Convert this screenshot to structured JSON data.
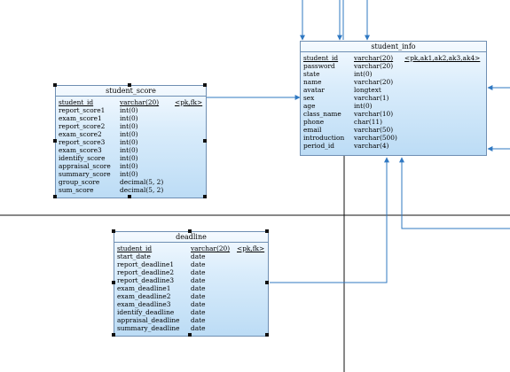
{
  "tables": {
    "student_info": {
      "title": "student_info",
      "pk_row": {
        "name": "student_id",
        "type": "varchar(20)",
        "keys": "<pk,ak1,ak2,ak3,ak4>"
      },
      "rows": [
        {
          "name": "password",
          "type": "varchar(20)"
        },
        {
          "name": "state",
          "type": "int(0)"
        },
        {
          "name": "name",
          "type": "varchar(20)"
        },
        {
          "name": "avatar",
          "type": "longtext"
        },
        {
          "name": "sex",
          "type": "varchar(1)"
        },
        {
          "name": "age",
          "type": "int(0)"
        },
        {
          "name": "class_name",
          "type": "varchar(10)"
        },
        {
          "name": "phone",
          "type": "char(11)"
        },
        {
          "name": "email",
          "type": "varchar(50)"
        },
        {
          "name": "introduction",
          "type": "varchar(500)"
        },
        {
          "name": "period_id",
          "type": "varchar(4)"
        }
      ]
    },
    "student_score": {
      "title": "student_score",
      "pk_row": {
        "name": "student_id",
        "type": "varchar(20)",
        "keys": "<pk,fk>"
      },
      "rows": [
        {
          "name": "report_score1",
          "type": "int(0)"
        },
        {
          "name": "exam_score1",
          "type": "int(0)"
        },
        {
          "name": "report_score2",
          "type": "int(0)"
        },
        {
          "name": "exam_score2",
          "type": "int(0)"
        },
        {
          "name": "report_score3",
          "type": "int(0)"
        },
        {
          "name": "exam_score3",
          "type": "int(0)"
        },
        {
          "name": "identify_score",
          "type": "int(0)"
        },
        {
          "name": "appraisal_score",
          "type": "int(0)"
        },
        {
          "name": "summary_score",
          "type": "int(0)"
        },
        {
          "name": "group_score",
          "type": "decimal(5, 2)"
        },
        {
          "name": "sum_score",
          "type": "decimal(5, 2)"
        }
      ]
    },
    "deadline": {
      "title": "deadline",
      "pk_row": {
        "name": "student_id",
        "type": "varchar(20)",
        "keys": "<pk,fk>"
      },
      "rows": [
        {
          "name": "start_date",
          "type": "date"
        },
        {
          "name": "report_deadline1",
          "type": "date"
        },
        {
          "name": "report_deadline2",
          "type": "date"
        },
        {
          "name": "report_deadline3",
          "type": "date"
        },
        {
          "name": "exam_deadline1",
          "type": "date"
        },
        {
          "name": "exam_deadline2",
          "type": "date"
        },
        {
          "name": "exam_deadline3",
          "type": "date"
        },
        {
          "name": "identify_deadline",
          "type": "date"
        },
        {
          "name": "appraisal_deadline",
          "type": "date"
        },
        {
          "name": "summary_deadline",
          "type": "date"
        }
      ]
    }
  },
  "colors": {
    "connector": "#2f78c2",
    "divider": "#111111",
    "table_border": "#6f8fb3",
    "table_fill_light": "#f5faff",
    "table_fill_dark": "#bcdcf5"
  }
}
